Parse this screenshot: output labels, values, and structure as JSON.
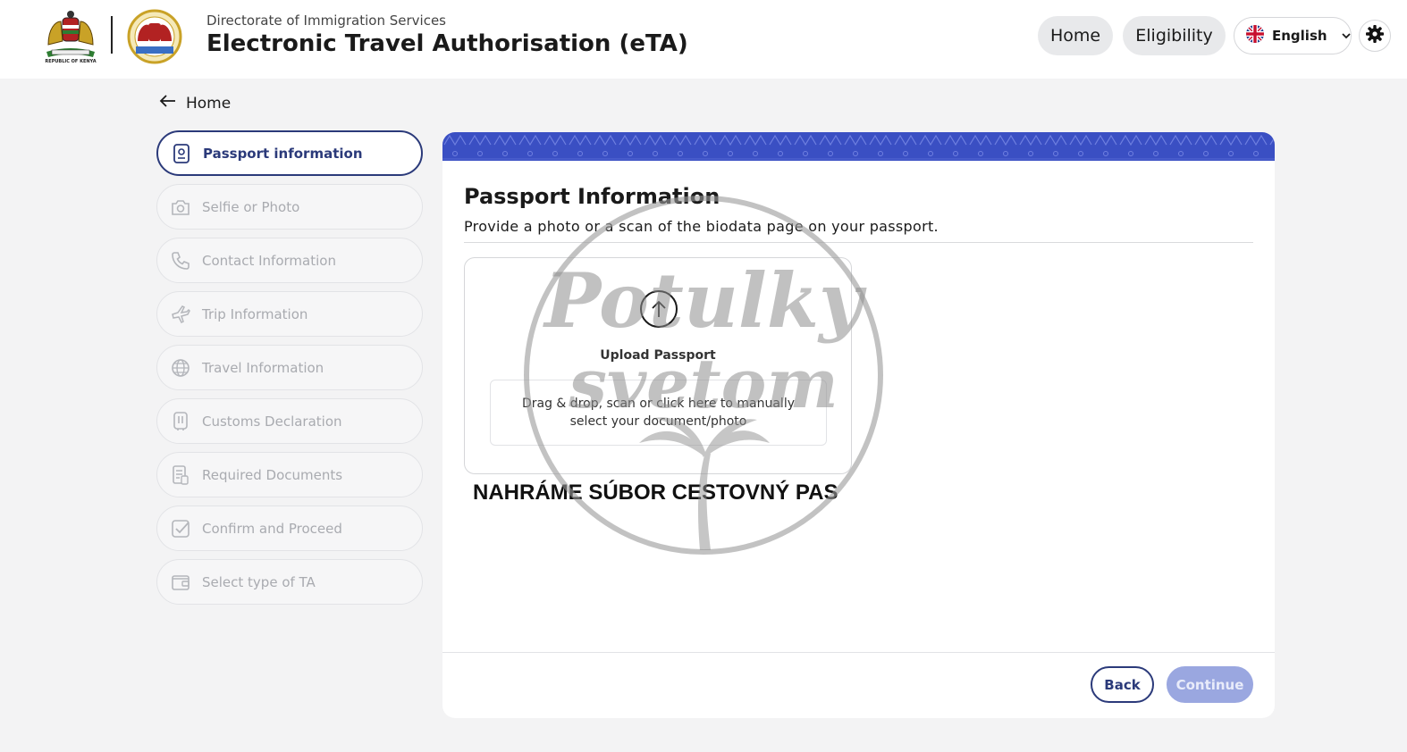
{
  "header": {
    "department": "Directorate of Immigration Services",
    "title": "Electronic Travel Authorisation (eTA)",
    "coat_caption": "REPUBLIC OF KENYA",
    "nav_home": "Home",
    "nav_eligibility": "Eligibility",
    "language": "English"
  },
  "back_link": "Home",
  "steps": [
    {
      "label": "Passport information",
      "icon": "passport-icon",
      "active": true
    },
    {
      "label": "Selfie or Photo",
      "icon": "camera-icon",
      "active": false
    },
    {
      "label": "Contact Information",
      "icon": "phone-icon",
      "active": false
    },
    {
      "label": "Trip Information",
      "icon": "airplane-icon",
      "active": false
    },
    {
      "label": "Travel Information",
      "icon": "globe-icon",
      "active": false
    },
    {
      "label": "Customs Declaration",
      "icon": "customs-icon",
      "active": false
    },
    {
      "label": "Required Documents",
      "icon": "documents-icon",
      "active": false
    },
    {
      "label": "Confirm and Proceed",
      "icon": "checkbox-icon",
      "active": false
    },
    {
      "label": "Select type of TA",
      "icon": "wallet-icon",
      "active": false
    }
  ],
  "main": {
    "title": "Passport Information",
    "subtitle": "Provide a photo or a scan of the biodata page on your passport.",
    "upload_label": "Upload Passport",
    "dropzone_text": "Drag & drop, scan or click here to manually select your document/photo",
    "caption": "NAHRÁME SÚBOR CESTOVNÝ PAS",
    "back_button": "Back",
    "continue_button": "Continue"
  },
  "watermark": {
    "line1": "Potulky",
    "line2": "svetom"
  },
  "colors": {
    "accent": "#2b3a7a",
    "banner": "#3a4fc3",
    "continue_disabled": "#9aa7e0"
  }
}
